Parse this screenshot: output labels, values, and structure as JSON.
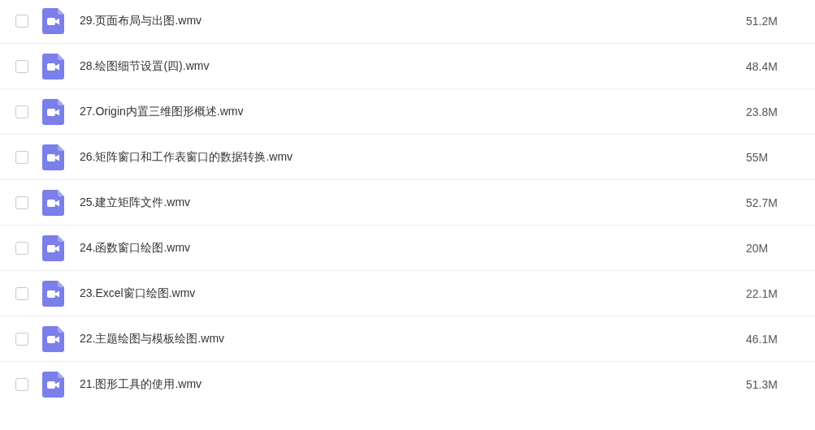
{
  "files": [
    {
      "name": "29.页面布局与出图.wmv",
      "size": "51.2M",
      "checked": false
    },
    {
      "name": "28.绘图细节设置(四).wmv",
      "size": "48.4M",
      "checked": false
    },
    {
      "name": "27.Origin内置三维图形概述.wmv",
      "size": "23.8M",
      "checked": false
    },
    {
      "name": "26.矩阵窗口和工作表窗口的数据转换.wmv",
      "size": "55M",
      "checked": false
    },
    {
      "name": "25.建立矩阵文件.wmv",
      "size": "52.7M",
      "checked": false
    },
    {
      "name": "24.函数窗口绘图.wmv",
      "size": "20M",
      "checked": false
    },
    {
      "name": "23.Excel窗口绘图.wmv",
      "size": "22.1M",
      "checked": false
    },
    {
      "name": "22.主题绘图与模板绘图.wmv",
      "size": "46.1M",
      "checked": false
    },
    {
      "name": "21.图形工具的使用.wmv",
      "size": "51.3M",
      "checked": false
    }
  ]
}
